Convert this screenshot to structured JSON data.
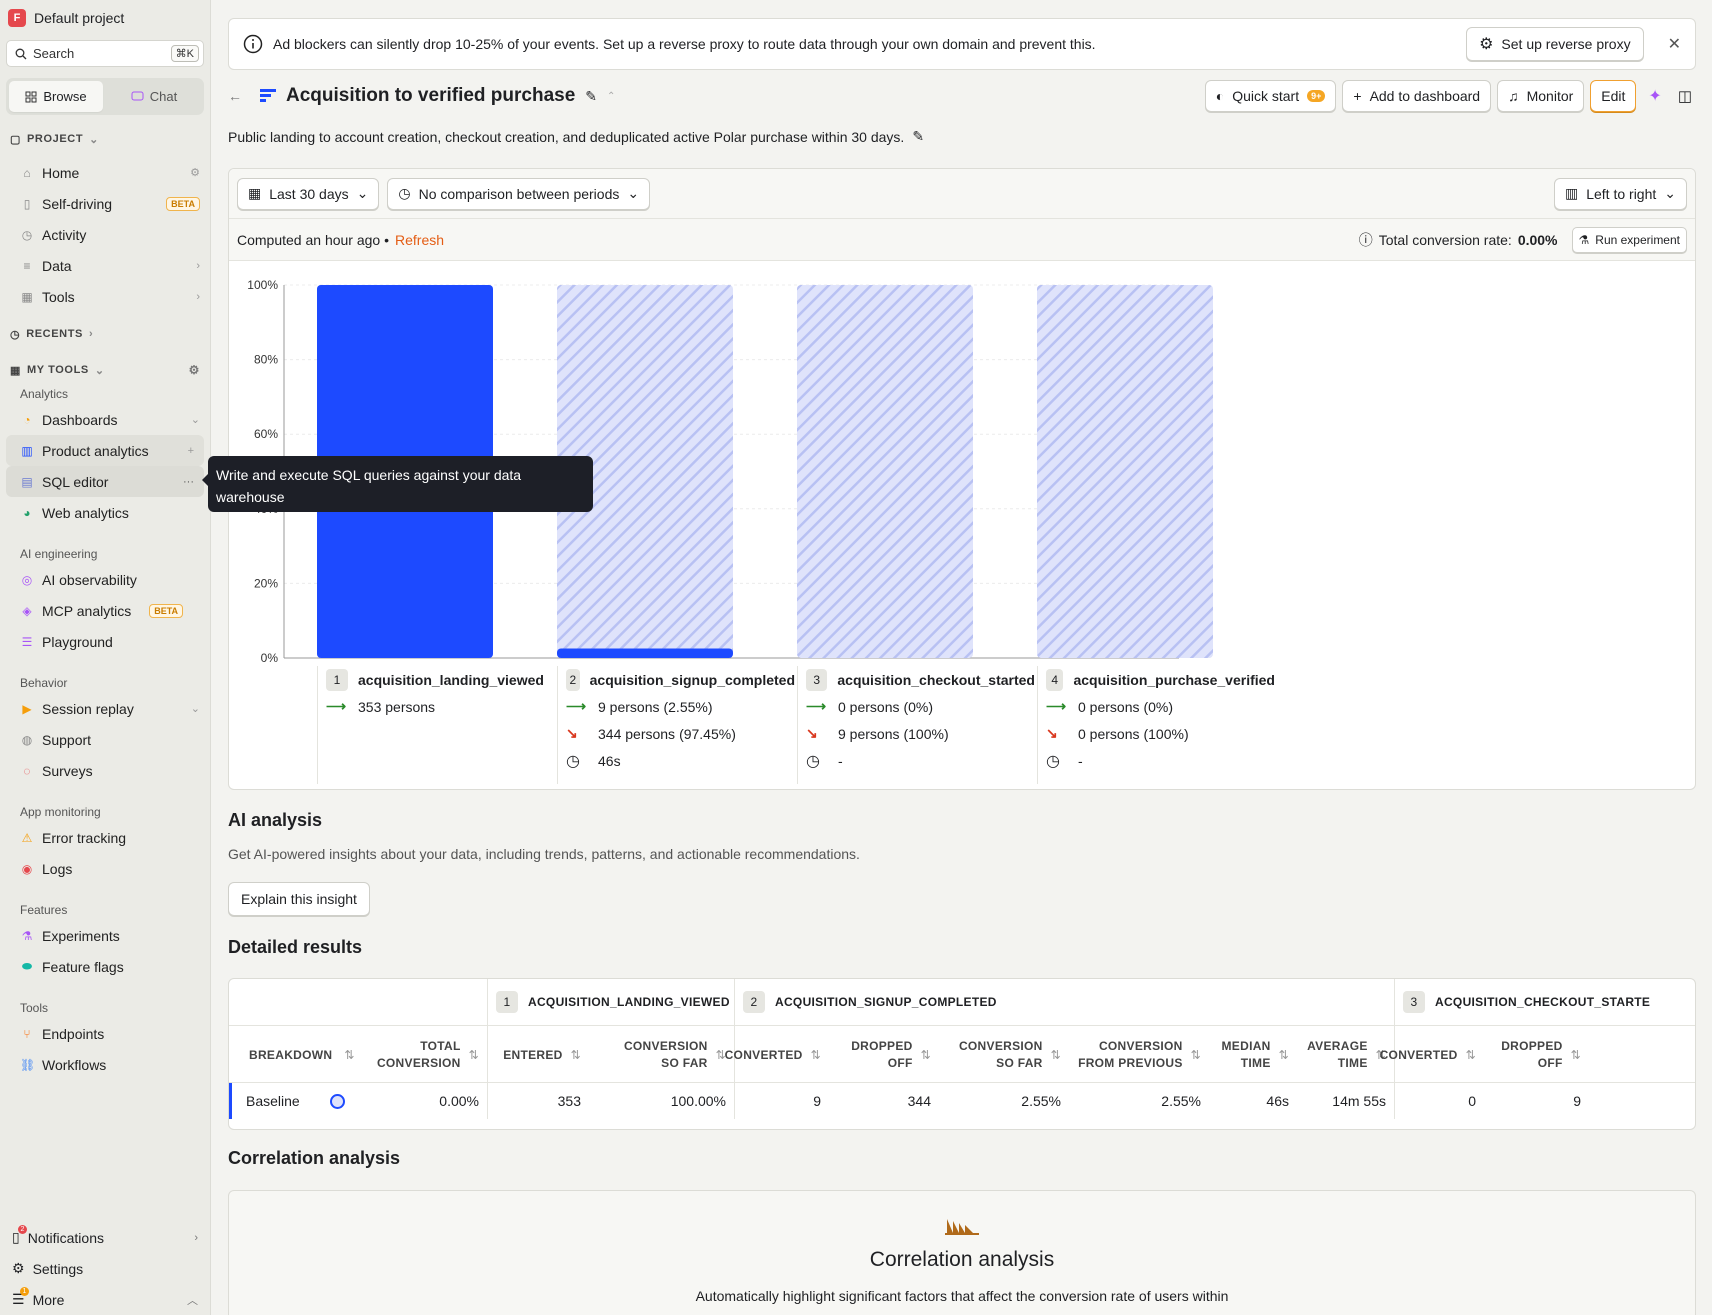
{
  "sidebar": {
    "project_initial": "F",
    "project_name": "Default project",
    "search_label": "Search",
    "search_shortcut": "⌘K",
    "browse_label": "Browse",
    "chat_label": "Chat",
    "project_section": "PROJECT",
    "project_items": [
      {
        "label": "Home",
        "icon": "home-icon"
      },
      {
        "label": "Self-driving",
        "icon": "file-icon",
        "badge": "BETA"
      },
      {
        "label": "Activity",
        "icon": "clock-icon"
      },
      {
        "label": "Data",
        "icon": "database-icon"
      },
      {
        "label": "Tools",
        "icon": "grid-icon"
      }
    ],
    "recents_section": "RECENTS",
    "mytools_section": "MY TOOLS",
    "groups": [
      {
        "label": "Analytics",
        "items": [
          "Dashboards",
          "Product analytics",
          "SQL editor",
          "Web analytics"
        ]
      },
      {
        "label": "AI engineering",
        "items": [
          "AI observability",
          "MCP analytics",
          "Playground"
        ],
        "badge": "BETA"
      },
      {
        "label": "Behavior",
        "items": [
          "Session replay",
          "Support",
          "Surveys"
        ]
      },
      {
        "label": "App monitoring",
        "items": [
          "Error tracking",
          "Logs"
        ]
      },
      {
        "label": "Features",
        "items": [
          "Experiments",
          "Feature flags"
        ]
      },
      {
        "label": "Tools",
        "items": [
          "Endpoints",
          "Workflows"
        ]
      }
    ],
    "notifications_label": "Notifications",
    "notifications_count": "2",
    "settings_label": "Settings",
    "more_label": "More",
    "more_count": "1"
  },
  "tooltip": {
    "text": "Write and execute SQL queries against your data warehouse"
  },
  "banner": {
    "text": "Ad blockers can silently drop 10-25% of your events. Set up a reverse proxy to route data through your own domain and prevent this.",
    "button": "Set up reverse proxy",
    "close": "✕"
  },
  "header": {
    "title": "Acquisition to verified purchase",
    "quick_start": "Quick start",
    "quick_start_badge": "9+",
    "add_dashboard": "Add to dashboard",
    "monitor": "Monitor",
    "edit": "Edit",
    "description": "Public landing to account creation, checkout creation, and deduplicated active Polar purchase within 30 days."
  },
  "filters": {
    "date_range": "Last 30 days",
    "comparison": "No comparison between periods",
    "layout": "Left to right",
    "computed": "Computed an hour ago •",
    "refresh": "Refresh",
    "total_conversion_label": "Total conversion rate:",
    "total_conversion_value": "0.00%",
    "run_experiment": "Run experiment"
  },
  "chart_data": {
    "type": "bar",
    "categories": [
      "acquisition_landing_viewed",
      "acquisition_signup_completed",
      "acquisition_checkout_started",
      "acquisition_purchase_verified"
    ],
    "values": [
      100,
      2.55,
      0,
      0
    ],
    "ylim": [
      0,
      100
    ],
    "yticks": [
      "0%",
      "20%",
      "40%",
      "60%",
      "80%",
      "100%"
    ],
    "colors": {
      "bar": "#1d4aff",
      "hatch": "#c6cdf8"
    }
  },
  "steps": [
    {
      "num": "1",
      "name": "acquisition_landing_viewed",
      "converted": "353 persons",
      "dropped": "",
      "time": ""
    },
    {
      "num": "2",
      "name": "acquisition_signup_completed",
      "converted": "9 persons",
      "converted_pct": "(2.55%)",
      "dropped": "344 persons",
      "dropped_pct": "(97.45%)",
      "time": "46s"
    },
    {
      "num": "3",
      "name": "acquisition_checkout_started",
      "converted": "0 persons",
      "converted_pct": "(0%)",
      "dropped": "9 persons",
      "dropped_pct": "(100%)",
      "time": "-"
    },
    {
      "num": "4",
      "name": "acquisition_purchase_verified",
      "converted": "0 persons",
      "converted_pct": "(0%)",
      "dropped": "0 persons",
      "dropped_pct": "(100%)",
      "time": "-"
    }
  ],
  "ai": {
    "title": "AI analysis",
    "subtitle": "Get AI-powered insights about your data, including trends, patterns, and actionable recommendations.",
    "button": "Explain this insight"
  },
  "detailed": {
    "title": "Detailed results",
    "group_headers": [
      {
        "num": "1",
        "name": "ACQUISITION_LANDING_VIEWED"
      },
      {
        "num": "2",
        "name": "ACQUISITION_SIGNUP_COMPLETED"
      },
      {
        "num": "3",
        "name": "ACQUISITION_CHECKOUT_STARTE"
      }
    ],
    "columns": [
      {
        "l1": "BREAKDOWN",
        "l2": ""
      },
      {
        "l1": "TOTAL",
        "l2": "CONVERSION"
      },
      {
        "l1": "ENTERED",
        "l2": ""
      },
      {
        "l1": "CONVERSION",
        "l2": "SO FAR"
      },
      {
        "l1": "CONVERTED",
        "l2": ""
      },
      {
        "l1": "DROPPED OFF",
        "l2": ""
      },
      {
        "l1": "CONVERSION",
        "l2": "SO FAR"
      },
      {
        "l1": "CONVERSION",
        "l2": "FROM PREVIOUS"
      },
      {
        "l1": "MEDIAN",
        "l2": "TIME"
      },
      {
        "l1": "AVERAGE",
        "l2": "TIME"
      },
      {
        "l1": "CONVERTED",
        "l2": ""
      },
      {
        "l1": "DROPPED OFF",
        "l2": ""
      }
    ],
    "row": [
      "Baseline",
      "0.00%",
      "353",
      "100.00%",
      "9",
      "344",
      "2.55%",
      "2.55%",
      "46s",
      "14m 55s",
      "0",
      "9"
    ]
  },
  "correlation": {
    "title": "Correlation analysis",
    "card_title": "Correlation analysis",
    "card_text": "Automatically highlight significant factors that affect the conversion rate of users within"
  }
}
